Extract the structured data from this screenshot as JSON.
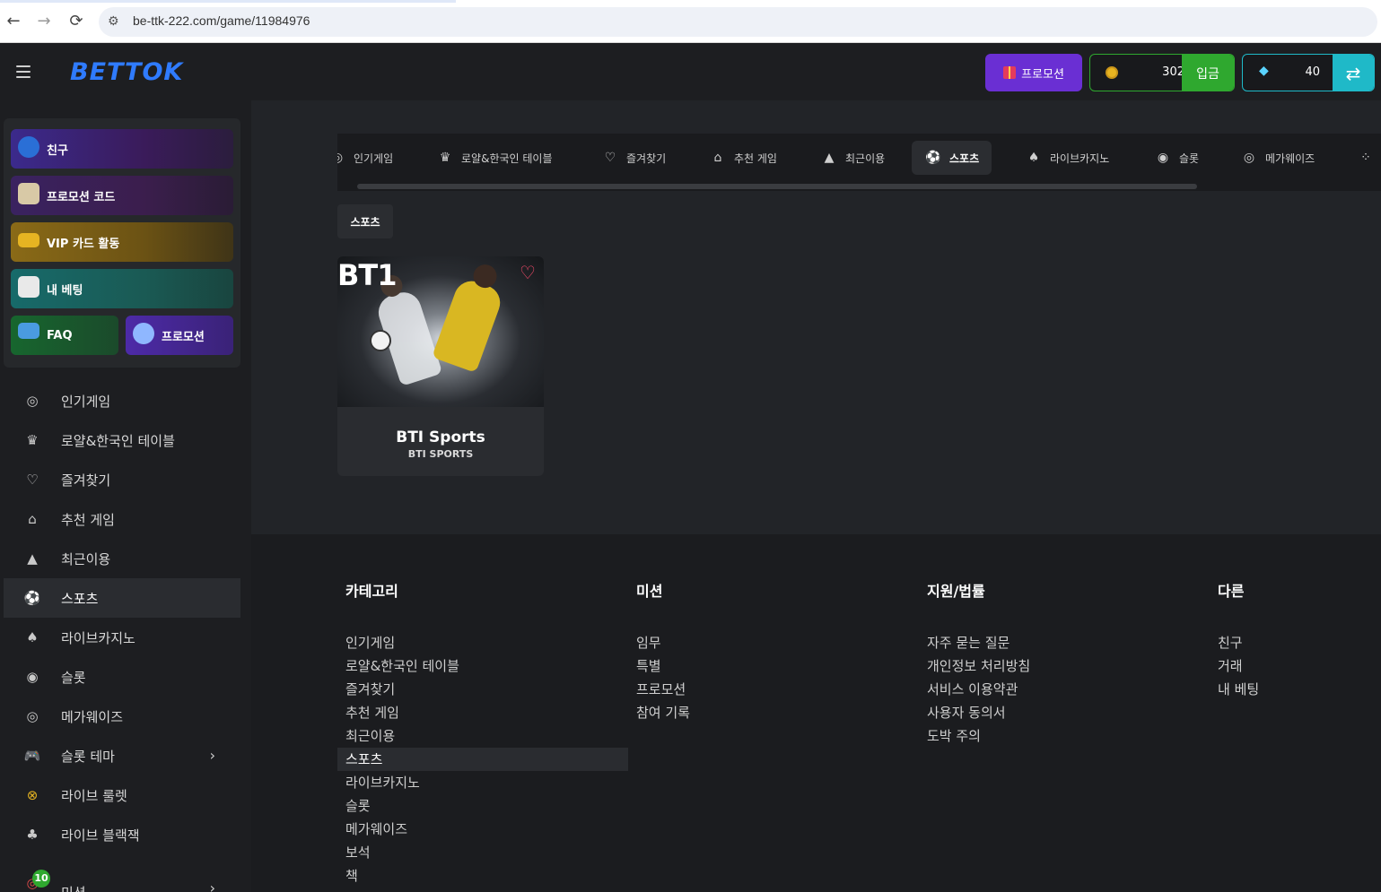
{
  "browser": {
    "url": "be-ttk-222.com/game/11984976",
    "back": "←",
    "forward": "→",
    "reload": "⟳"
  },
  "header": {
    "logo": "BETTOK",
    "promo_label": "프로모션",
    "coin_amount": "302",
    "deposit_label": "입금",
    "gem_amount": "40",
    "refresh_icon": "⇄"
  },
  "quick": {
    "friend": "친구",
    "promo_code": "프로모션 코드",
    "vip": "VIP 카드 활동",
    "my_bet": "내 베팅",
    "faq": "FAQ",
    "promo": "프로모션"
  },
  "sidebar": {
    "items": [
      {
        "label": "인기게임",
        "icon": "◎"
      },
      {
        "label": "로얄&한국인 테이블",
        "icon": "♛"
      },
      {
        "label": "즐겨찾기",
        "icon": "♡"
      },
      {
        "label": "추천 게임",
        "icon": "⌂"
      },
      {
        "label": "최근이용",
        "icon": "▲"
      },
      {
        "label": "스포츠",
        "icon": "⚽"
      },
      {
        "label": "라이브카지노",
        "icon": "♠"
      },
      {
        "label": "슬롯",
        "icon": "◉"
      },
      {
        "label": "메가웨이즈",
        "icon": "◎"
      },
      {
        "label": "슬롯 테마",
        "icon": "🎮",
        "chevron": "›"
      },
      {
        "label": "라이브 룰렛",
        "icon": "⊗"
      },
      {
        "label": "라이브 블랙잭",
        "icon": "♣"
      },
      {
        "label": "미션",
        "icon": "◎",
        "chevron": "›"
      }
    ],
    "mission_badge": "10"
  },
  "tabs": [
    {
      "label": "인기게임",
      "icon": "◎"
    },
    {
      "label": "로얄&한국인 테이블",
      "icon": "♛"
    },
    {
      "label": "즐겨찾기",
      "icon": "♡"
    },
    {
      "label": "추천 게임",
      "icon": "⌂"
    },
    {
      "label": "최근이용",
      "icon": "▲"
    },
    {
      "label": "스포츠",
      "icon": "⚽"
    },
    {
      "label": "라이브카지노",
      "icon": "♠"
    },
    {
      "label": "슬롯",
      "icon": "◉"
    },
    {
      "label": "메가웨이즈",
      "icon": "◎"
    },
    {
      "label": "",
      "icon": "⁘"
    }
  ],
  "category_chip": "스포츠",
  "game": {
    "thumb_text": "BT1",
    "name": "BTI Sports",
    "provider": "BTI SPORTS"
  },
  "footer": {
    "categories": {
      "title": "카테고리",
      "links": [
        "인기게임",
        "로얄&한국인 테이블",
        "즐겨찾기",
        "추천 게임",
        "최근이용",
        "스포츠",
        "라이브카지노",
        "슬롯",
        "메가웨이즈",
        "보석",
        "책"
      ]
    },
    "mission": {
      "title": "미션",
      "links": [
        "임무",
        "특별",
        "프로모션",
        "참여 기록"
      ]
    },
    "support": {
      "title": "지원/법률",
      "links": [
        "자주 묻는 질문",
        "개인정보 처리방침",
        "서비스 이용약관",
        "사용자 동의서",
        "도박 주의"
      ]
    },
    "other": {
      "title": "다른",
      "links": [
        "친구",
        "거래",
        "내 베팅"
      ]
    }
  }
}
